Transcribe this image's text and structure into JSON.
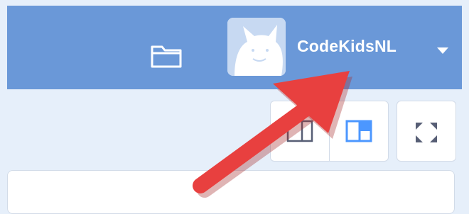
{
  "menu_bar": {
    "username": "CodeKidsNL",
    "icons": {
      "folder": "folder-icon",
      "avatar": "scratch-cat-avatar",
      "caret": "caret-down-icon"
    }
  },
  "stage_controls": {
    "buttons": [
      {
        "name": "small-stage-mode",
        "icon": "small-stage-icon"
      },
      {
        "name": "large-stage-mode",
        "icon": "large-stage-icon",
        "selected": true
      },
      {
        "name": "full-screen",
        "icon": "fullscreen-icon"
      }
    ]
  },
  "annotation": {
    "type": "arrow",
    "color": "#e8403f"
  },
  "colors": {
    "menu_bar": "#6a98d8",
    "accent": "#4c97ff",
    "background": "#e6effa",
    "panel": "#ffffff"
  }
}
